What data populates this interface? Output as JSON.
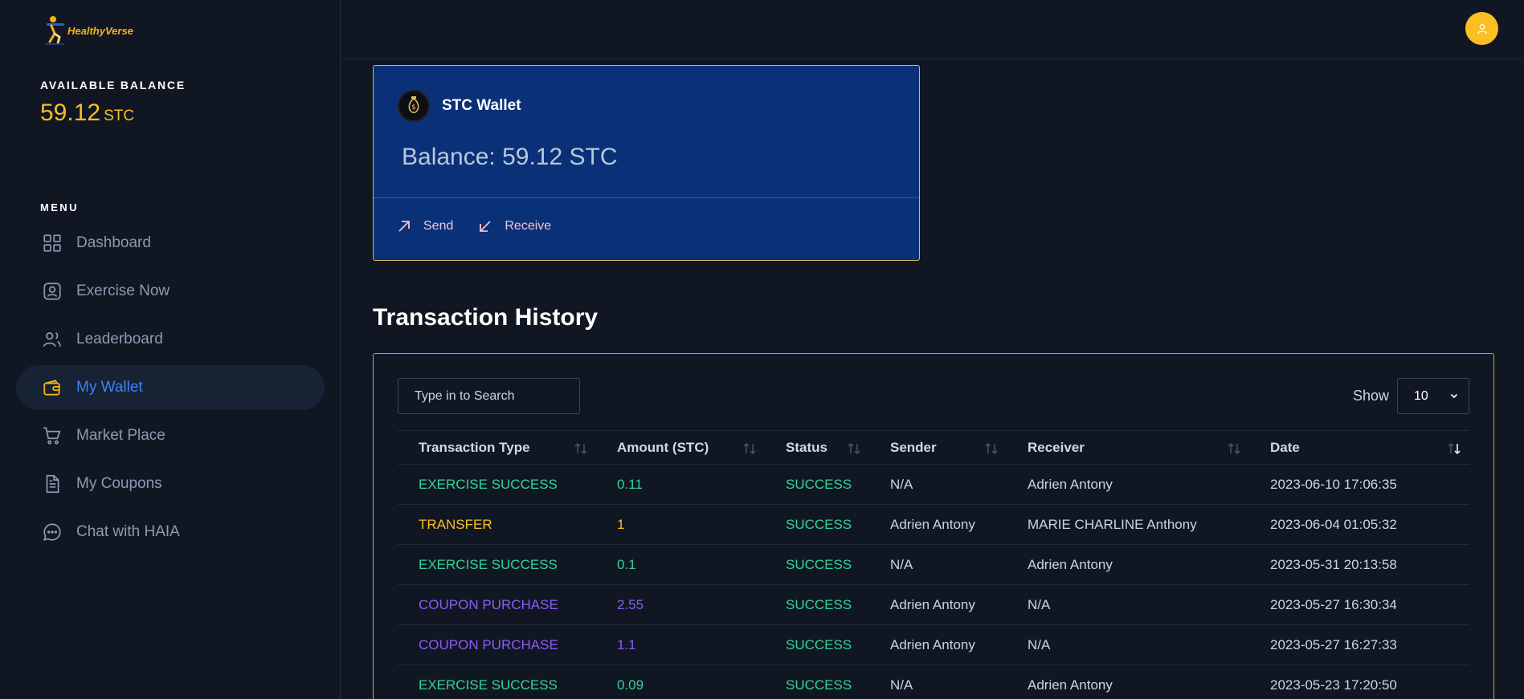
{
  "brand": {
    "name": "HealthyVerse",
    "color": "#f6b21a"
  },
  "sidebar": {
    "balance_label": "AVAILABLE BALANCE",
    "balance_value": "59.12",
    "balance_unit": "STC",
    "menu_label": "MENU",
    "items": [
      {
        "label": "Dashboard",
        "icon": "grid-icon"
      },
      {
        "label": "Exercise Now",
        "icon": "user-square-icon"
      },
      {
        "label": "Leaderboard",
        "icon": "users-icon"
      },
      {
        "label": "My Wallet",
        "icon": "wallet-icon",
        "active": true
      },
      {
        "label": "Market Place",
        "icon": "cart-icon"
      },
      {
        "label": "My Coupons",
        "icon": "document-icon"
      },
      {
        "label": "Chat with HAIA",
        "icon": "chat-icon"
      }
    ]
  },
  "wallet": {
    "title": "STC Wallet",
    "balance": "Balance: 59.12 STC",
    "send_label": "Send",
    "receive_label": "Receive"
  },
  "transactions": {
    "title": "Transaction History",
    "search_placeholder": "Type in to Search",
    "show_label": "Show",
    "show_value": "10",
    "columns": [
      "Transaction Type",
      "Amount (STC)",
      "Status",
      "Sender",
      "Receiver",
      "Date"
    ],
    "rows": [
      {
        "type": "EXERCISE SUCCESS",
        "amount": "0.11",
        "status": "SUCCESS",
        "sender": "N/A",
        "receiver": "Adrien Antony",
        "date": "2023-06-10 17:06:35",
        "tone": "green"
      },
      {
        "type": "TRANSFER",
        "amount": "1",
        "status": "SUCCESS",
        "sender": "Adrien Antony",
        "receiver": "MARIE CHARLINE Anthony",
        "date": "2023-06-04 01:05:32",
        "tone": "amber"
      },
      {
        "type": "EXERCISE SUCCESS",
        "amount": "0.1",
        "status": "SUCCESS",
        "sender": "N/A",
        "receiver": "Adrien Antony",
        "date": "2023-05-31 20:13:58",
        "tone": "green"
      },
      {
        "type": "COUPON PURCHASE",
        "amount": "2.55",
        "status": "SUCCESS",
        "sender": "Adrien Antony",
        "receiver": "N/A",
        "date": "2023-05-27 16:30:34",
        "tone": "purple"
      },
      {
        "type": "COUPON PURCHASE",
        "amount": "1.1",
        "status": "SUCCESS",
        "sender": "Adrien Antony",
        "receiver": "N/A",
        "date": "2023-05-27 16:27:33",
        "tone": "purple"
      },
      {
        "type": "EXERCISE SUCCESS",
        "amount": "0.09",
        "status": "SUCCESS",
        "sender": "N/A",
        "receiver": "Adrien Antony",
        "date": "2023-05-23 17:20:50",
        "tone": "green"
      }
    ]
  },
  "colors": {
    "background": "#101723",
    "accent_yellow": "#fbbf24",
    "accent_blue": "#3b82f6",
    "wallet_card": "#0a3178",
    "success_green": "#34d399",
    "coupon_purple": "#8b5cf6"
  }
}
